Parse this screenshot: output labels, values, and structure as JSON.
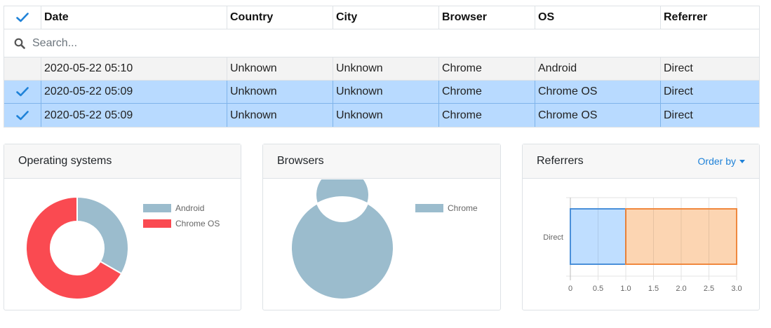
{
  "table": {
    "columns": [
      "Date",
      "Country",
      "City",
      "Browser",
      "OS",
      "Referrer"
    ],
    "search_placeholder": "Search...",
    "rows": [
      {
        "selected": false,
        "cells": [
          "2020-05-22 05:10",
          "Unknown",
          "Unknown",
          "Chrome",
          "Android",
          "Direct"
        ]
      },
      {
        "selected": true,
        "cells": [
          "2020-05-22 05:09",
          "Unknown",
          "Unknown",
          "Chrome",
          "Chrome OS",
          "Direct"
        ]
      },
      {
        "selected": true,
        "cells": [
          "2020-05-22 05:09",
          "Unknown",
          "Unknown",
          "Chrome",
          "Chrome OS",
          "Direct"
        ]
      }
    ]
  },
  "icons": {
    "select_all": "check-icon",
    "search": "search-icon",
    "row_check": "check-icon"
  },
  "colors": {
    "accent": "#1f82d8",
    "selected_row": "#b8daff",
    "android": "#9bbccd",
    "chrome_os": "#fa4a51",
    "chrome": "#9bbccd",
    "bar_blue": "#b8daff",
    "bar_blue_stroke": "#4a90d9",
    "bar_orange": "#fcd0aa",
    "bar_orange_stroke": "#f0883e"
  },
  "panels": {
    "os": {
      "title": "Operating systems"
    },
    "browsers": {
      "title": "Browsers"
    },
    "referrers": {
      "title": "Referrers",
      "order_by": "Order by"
    }
  },
  "chart_data": [
    {
      "type": "pie",
      "title": "Operating systems",
      "categories": [
        "Android",
        "Chrome OS"
      ],
      "values": [
        1,
        2
      ]
    },
    {
      "type": "pie",
      "title": "Browsers",
      "categories": [
        "Chrome"
      ],
      "values": [
        3
      ]
    },
    {
      "type": "bar",
      "orientation": "horizontal",
      "stacked": true,
      "title": "Referrers",
      "categories": [
        "Direct"
      ],
      "series": [
        {
          "values": [
            1
          ]
        },
        {
          "values": [
            2
          ]
        }
      ],
      "xlim": [
        0,
        3
      ],
      "xticks": [
        "0",
        "0.5",
        "1.0",
        "1.5",
        "2.0",
        "2.5",
        "3.0"
      ],
      "grid": true
    }
  ]
}
